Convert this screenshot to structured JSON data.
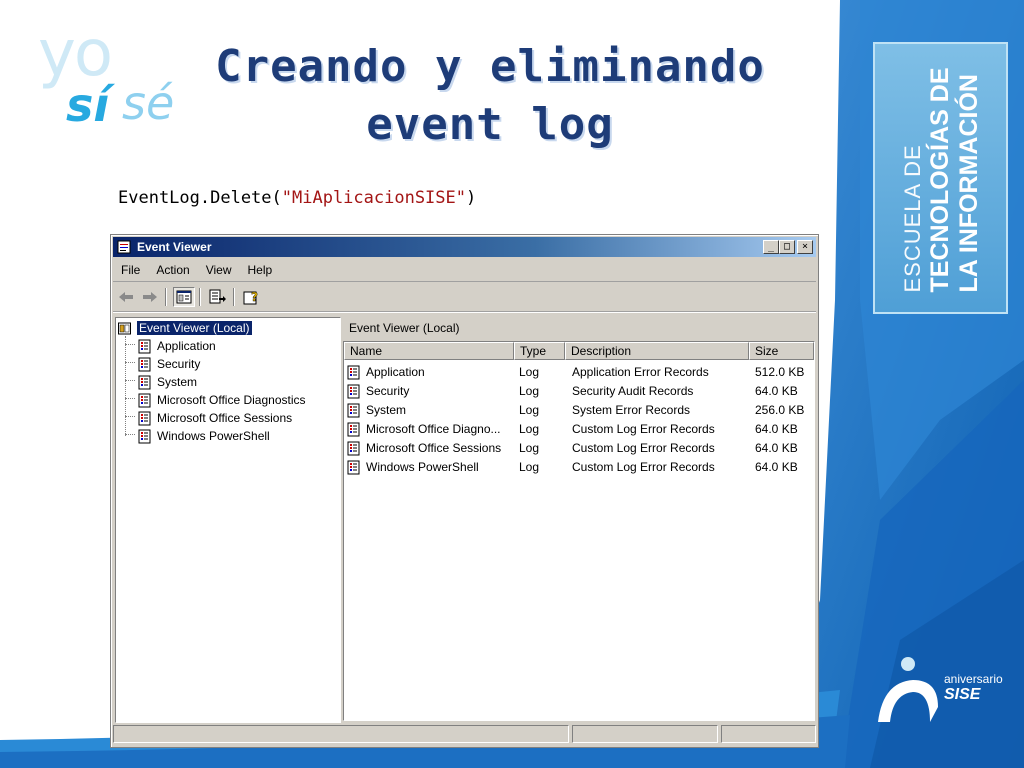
{
  "slide": {
    "logo": {
      "yo": "yo",
      "si": "sí",
      "se": "sé"
    },
    "title_line1": "Creando y eliminando",
    "title_line2": "event log",
    "code_prefix": "EventLog.Delete(",
    "code_string": "\"MiAplicacionSISE\"",
    "code_suffix": ")",
    "side_label": {
      "line1": "ESCUELA DE",
      "line2": "TECNOLOGÍAS DE",
      "line3": "LA INFORMACIÓN"
    },
    "anniversary": {
      "line1": "aniversario",
      "line2": "SISE"
    },
    "colors": {
      "title": "#1e3c78",
      "side_panel": "#4f9fd6",
      "deco_blue": "#1a6fc0",
      "selection": "#0a246a"
    }
  },
  "window": {
    "title": "Event Viewer",
    "controls": {
      "minimize": "_",
      "maximize": "□",
      "close": "×"
    },
    "menu": [
      "File",
      "Action",
      "View",
      "Help"
    ],
    "toolbar_icons": [
      "back-arrow-icon",
      "forward-arrow-icon",
      "show-hide-tree-icon",
      "export-list-icon",
      "help-icon"
    ],
    "tree": {
      "root": "Event Viewer (Local)",
      "items": [
        "Application",
        "Security",
        "System",
        "Microsoft Office Diagnostics",
        "Microsoft Office Sessions",
        "Windows PowerShell"
      ]
    },
    "right_header": "Event Viewer (Local)",
    "columns": [
      "Name",
      "Type",
      "Description",
      "Size"
    ],
    "rows": [
      {
        "name": "Application",
        "type": "Log",
        "description": "Application Error Records",
        "size": "512.0 KB"
      },
      {
        "name": "Security",
        "type": "Log",
        "description": "Security Audit Records",
        "size": "64.0 KB"
      },
      {
        "name": "System",
        "type": "Log",
        "description": "System Error Records",
        "size": "256.0 KB"
      },
      {
        "name": "Microsoft Office Diagno...",
        "type": "Log",
        "description": "Custom Log Error Records",
        "size": "64.0 KB"
      },
      {
        "name": "Microsoft Office Sessions",
        "type": "Log",
        "description": "Custom Log Error Records",
        "size": "64.0 KB"
      },
      {
        "name": "Windows PowerShell",
        "type": "Log",
        "description": "Custom Log Error Records",
        "size": "64.0 KB"
      }
    ]
  }
}
